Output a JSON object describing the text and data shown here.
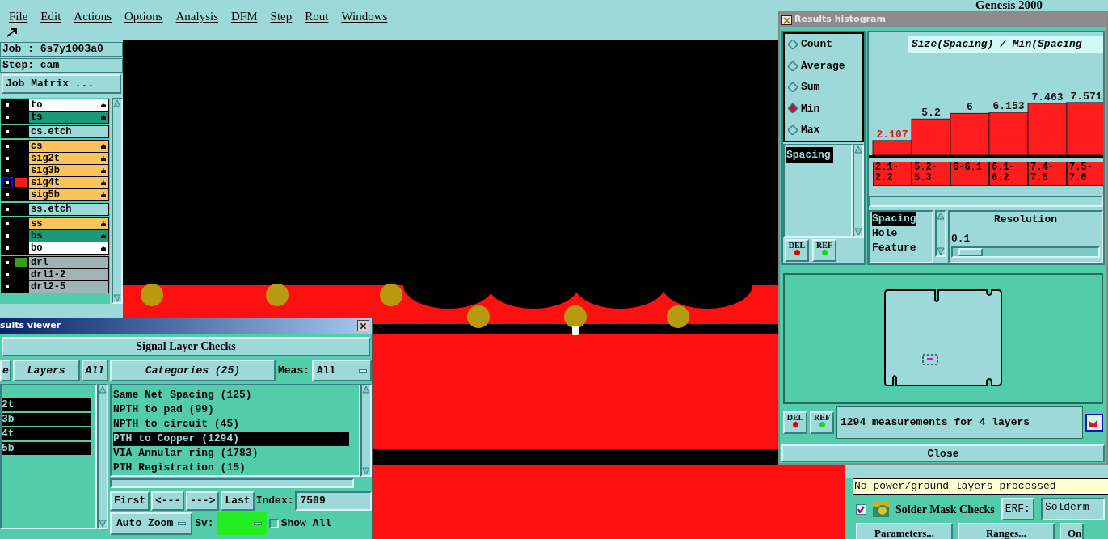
{
  "menu": [
    "File",
    "Edit",
    "Actions",
    "Options",
    "Analysis",
    "DFM",
    "Step",
    "Rout",
    "Windows"
  ],
  "app_title": "Genesis 2000",
  "job": "Job : 6s7y1003a0",
  "step": "Step: cam",
  "job_matrix": "Job Matrix ...",
  "layer_groups": [
    [
      {
        "name": "to",
        "kind": "silk",
        "hand": true,
        "selected": false
      },
      {
        "name": "ts",
        "kind": "mask",
        "hand": true,
        "selected": false
      }
    ],
    [
      {
        "name": "cs.etch",
        "kind": "document",
        "hand": false,
        "selected": false
      }
    ],
    [
      {
        "name": "cs",
        "kind": "signal",
        "hand": true,
        "selected": false
      },
      {
        "name": "sig2t",
        "kind": "signal",
        "hand": true,
        "selected": false
      },
      {
        "name": "sig3b",
        "kind": "signal",
        "hand": true,
        "selected": false
      },
      {
        "name": "sig4t",
        "kind": "signal",
        "hand": true,
        "selected": true,
        "color": "#ff1818"
      },
      {
        "name": "sig5b",
        "kind": "signal",
        "hand": true,
        "selected": false
      }
    ],
    [
      {
        "name": "ss.etch",
        "kind": "document",
        "hand": false,
        "selected": false
      }
    ],
    [
      {
        "name": "ss",
        "kind": "signal",
        "hand": true,
        "selected": false
      },
      {
        "name": "bs",
        "kind": "mask",
        "hand": true,
        "selected": false
      },
      {
        "name": "bo",
        "kind": "silk",
        "hand": true,
        "selected": false
      }
    ],
    [
      {
        "name": "drl",
        "kind": "drill",
        "hand": false,
        "selected": false,
        "color": "#3c9a1c"
      },
      {
        "name": "drl1-2",
        "kind": "drill",
        "hand": false,
        "selected": false
      },
      {
        "name": "drl2-5",
        "kind": "drill",
        "hand": false,
        "selected": false
      }
    ]
  ],
  "results_viewer": {
    "title": "sults viewer",
    "heading": "Signal Layer Checks",
    "layer_buttons": [
      "e",
      "Layers",
      "All"
    ],
    "layers": [
      {
        "name": "2t",
        "selected": true
      },
      {
        "name": "3b",
        "selected": true
      },
      {
        "name": "4t",
        "selected": true
      },
      {
        "name": "5b",
        "selected": true
      }
    ],
    "categories_button": "Categories (25)",
    "meas_label": "Meas:",
    "meas_value": "All",
    "categories": [
      {
        "name": "Same Net Spacing (125)",
        "selected": false
      },
      {
        "name": "NPTH to pad (99)",
        "selected": false
      },
      {
        "name": "NPTH to circuit (45)",
        "selected": false
      },
      {
        "name": "PTH to Copper (1294)",
        "selected": true
      },
      {
        "name": "VIA Annular ring (1783)",
        "selected": false
      },
      {
        "name": "PTH Registration (15)",
        "selected": false
      }
    ],
    "nav": [
      "First",
      "<---",
      "--->",
      "Last"
    ],
    "index_label": "Index:",
    "index": "7509",
    "zoom": "Auto Zoom",
    "sv": {
      "label": "Sv:",
      "color": "#22ee22"
    },
    "show_all": {
      "label": "Show All",
      "checked": false
    }
  },
  "histogram": {
    "title": "Results histogram",
    "modes": [
      {
        "label": "Count",
        "selected": false
      },
      {
        "label": "Average",
        "selected": false
      },
      {
        "label": "Sum",
        "selected": false
      },
      {
        "label": "Min",
        "selected": true
      },
      {
        "label": "Max",
        "selected": false
      }
    ],
    "measures": [
      "Spacing"
    ],
    "list_buttons": [
      "DEL",
      "REF"
    ],
    "chart_data": {
      "type": "bar",
      "title": "Size(Spacing) / Min(Spacing",
      "categories": [
        "2.1-2.2",
        "5.2-5.3",
        "6-6.1",
        "6.1-6.2",
        "7.4-7.5",
        "7.5-7.6"
      ],
      "values": [
        2.107,
        5.2,
        6,
        6.153,
        7.463,
        7.571
      ],
      "data_labels": true
    },
    "types": [
      {
        "label": "Spacing",
        "selected": true
      },
      {
        "label": "Hole",
        "selected": false
      },
      {
        "label": "Feature",
        "selected": false
      }
    ],
    "resolution_label": "Resolution",
    "resolution": "0.1",
    "resolution_slider": {
      "level": 0.04
    },
    "preview_buttons": [
      "DEL",
      "REF"
    ],
    "summary": "1294 measurements for 4 layers",
    "close": "Close"
  },
  "status": {
    "message": "No power/ground layers processed",
    "check": {
      "label": "Solder Mask Checks",
      "checked": true
    },
    "erf_label": "ERF:",
    "erf_value": "Solderm",
    "buttons": [
      "Parameters...",
      "Ranges...",
      "On"
    ]
  }
}
